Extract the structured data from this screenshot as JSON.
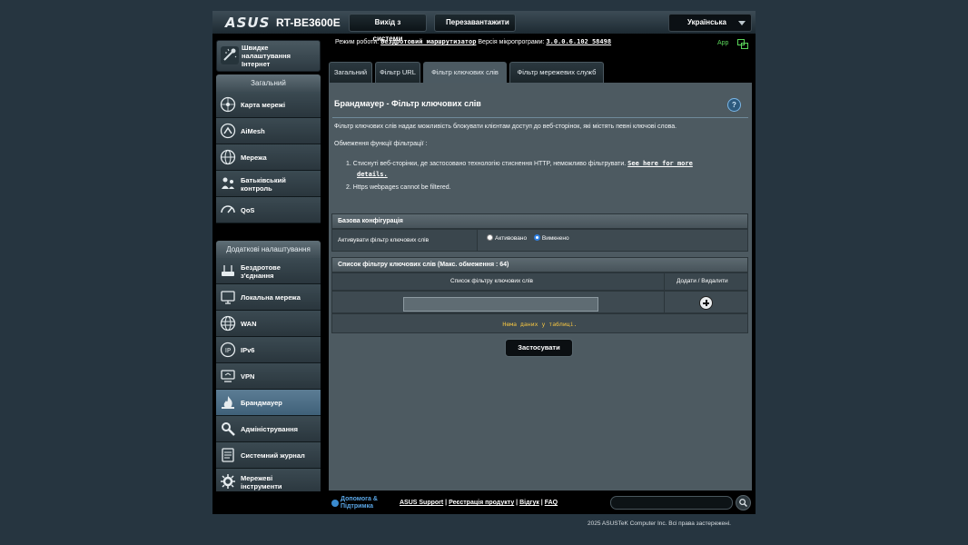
{
  "header": {
    "logo": "ASUS",
    "model": "RT-BE3600E",
    "logout_label": "Вихід з системи",
    "reboot_label": "Перезавантажити",
    "language": "Українська"
  },
  "sidebar": {
    "quick_internet": "Швидке налаштування Інтернет",
    "general_heading": "Загальний",
    "general_items": [
      {
        "label": "Карта мережі",
        "icon": "network-map-icon"
      },
      {
        "label": "AiMesh",
        "icon": "aimesh-icon"
      },
      {
        "label": "Мережа",
        "icon": "network-globe-icon"
      },
      {
        "label": "Батьківський контроль",
        "icon": "parental-control-icon"
      },
      {
        "label": "QoS",
        "icon": "qos-gauge-icon"
      }
    ],
    "advanced_heading": "Додаткові налаштування",
    "advanced_items": [
      {
        "label": "Бездротове з'єднання",
        "icon": "wireless-icon"
      },
      {
        "label": "Локальна мережа",
        "icon": "lan-icon"
      },
      {
        "label": "WAN",
        "icon": "wan-globe-icon"
      },
      {
        "label": "IPv6",
        "icon": "ipv6-icon"
      },
      {
        "label": "VPN",
        "icon": "vpn-icon"
      },
      {
        "label": "Брандмауер",
        "icon": "firewall-flame-icon"
      },
      {
        "label": "Адміністрування",
        "icon": "administration-icon"
      },
      {
        "label": "Системний журнал",
        "icon": "system-log-icon"
      },
      {
        "label": "Мережеві інструменти",
        "icon": "network-tools-icon"
      }
    ]
  },
  "status": {
    "mode_prefix": "Режим роботи:",
    "mode_value": "Бездротовий маршрутизатор",
    "firmware_prefix": "Версія мікропрограми:",
    "firmware_value": "3.0.0.6.102_58498",
    "app_label": "App"
  },
  "tabs": [
    "Загальний",
    "Фільтр URL",
    "Фільтр ключових слів",
    "Фільтр мережевих служб"
  ],
  "active_tab": "Фільтр ключових слів",
  "panel": {
    "title": "Брандмауер - Фільтр ключових слів",
    "help_icon": "?",
    "description": "Фільтр ключових слів надає можливість блокувати клієнтам доступ до веб-сторінок, які містять певні ключові слова.",
    "limitations_label": "Обмеження функції фільтрації :",
    "limit1_text": "1. Стиснуті веб-сторінки, де застосовано технологію стиснення HTTP, неможливо фільтрувати.",
    "limit1_link": "See here for more",
    "limit1_link_cont": "details.",
    "limit2_text": "2. Https webpages cannot be filtered."
  },
  "basic_config": {
    "heading": "Базова конфігурація",
    "enable_label": "Активувати фільтр ключових слів",
    "option_on": "Активовано",
    "option_off": "Вимкнено",
    "selected": "Вимкнено"
  },
  "keyword_list": {
    "heading": "Список фільтру ключових слів (Макс. обмеження : 64)",
    "col_list": "Список фільтру ключових слів",
    "col_action": "Додати / Видалити",
    "input_value": "",
    "empty_text": "Нема даних у таблиці."
  },
  "apply_label": "Застосувати",
  "footer": {
    "help_line1": "Допомога &",
    "help_line2": "Підтримка",
    "asus_support": "ASUS Support",
    "register": "Реєстрація продукту",
    "feedback": "Відгук",
    "faq": "FAQ",
    "search_value": "",
    "copyright": "2025 ASUSTeK Computer Inc. Всі права застережені."
  },
  "colors": {
    "page_bg": "#263540",
    "panel_bg": "#4d5a61",
    "active_menu": "#4f7189",
    "empty_text": "#f5c542",
    "link_blue": "#5aa6e6"
  }
}
